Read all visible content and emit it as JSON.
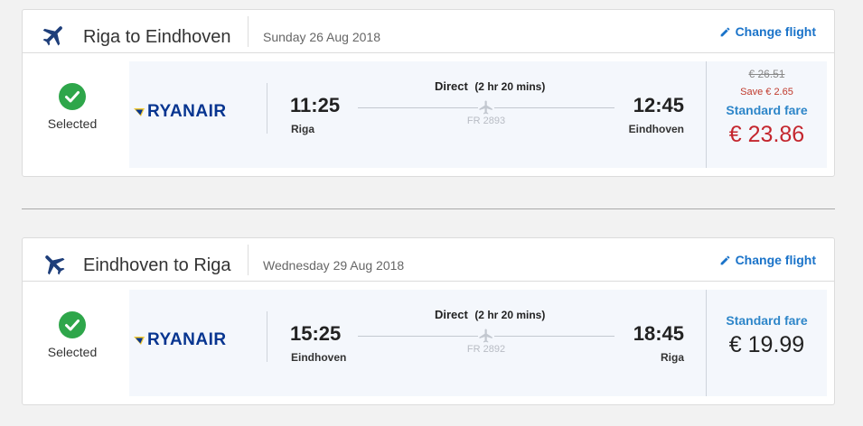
{
  "colors": {
    "accent": "#1a73c9",
    "navy": "#1e3e7a",
    "check": "#2ea64a",
    "discount": "#c4262e",
    "ryanair": "#073590"
  },
  "flights": [
    {
      "route": "Riga to Eindhoven",
      "date": "Sunday 26 Aug 2018",
      "change_label": "Change flight",
      "selected_label": "Selected",
      "airline": "RYANAIR",
      "departure_time": "11:25",
      "departure_city": "Riga",
      "arrival_time": "12:45",
      "arrival_city": "Eindhoven",
      "stops": "Direct",
      "duration": "(2 hr 20 mins)",
      "flight_number": "FR 2893",
      "old_price": "€ 26.51",
      "savings": "Save € 2.65",
      "fare_type": "Standard fare",
      "price": "€ 23.86"
    },
    {
      "route": "Eindhoven to Riga",
      "date": "Wednesday 29 Aug 2018",
      "change_label": "Change flight",
      "selected_label": "Selected",
      "airline": "RYANAIR",
      "departure_time": "15:25",
      "departure_city": "Eindhoven",
      "arrival_time": "18:45",
      "arrival_city": "Riga",
      "stops": "Direct",
      "duration": "(2 hr 20 mins)",
      "flight_number": "FR 2892",
      "fare_type": "Standard fare",
      "price": "€ 19.99"
    }
  ]
}
